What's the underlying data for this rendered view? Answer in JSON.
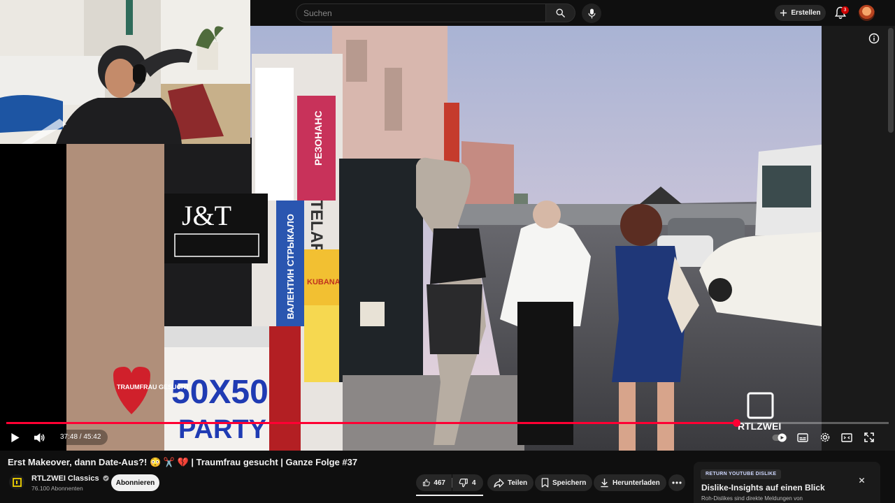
{
  "search": {
    "placeholder": "Suchen"
  },
  "header": {
    "create_label": "Erstellen",
    "notification_count": "3"
  },
  "player": {
    "current_time": "37:48",
    "duration": "45:42",
    "time_separator": " / ",
    "progress_fraction": 0.827,
    "overlay_show_logo": "TRAUMFRAU GESUCHT",
    "overlay_channel_logo": "RTLZWEI",
    "accent_color": "#ff0033"
  },
  "sign_texts": {
    "jt": "J&T",
    "party": "50X50",
    "party2": "PARTY",
    "stelar": "PAROV STELAR",
    "valentin": "ВАЛЕНТИН СТРЫКАЛО",
    "kubana": "KUBANA",
    "rezonans": "РЕЗОНАНС"
  },
  "video": {
    "title": "Erst Makeover, dann Date-Aus?! 😳 ✂️ 💔 | Traumfrau gesucht | Ganze Folge #37",
    "channel_name": "RTLZWEI Classics",
    "subscribers": "76.100 Abonnenten",
    "subscribe_label": "Abonnieren",
    "likes": "467",
    "dislikes": "4",
    "share_label": "Teilen",
    "save_label": "Speichern",
    "download_label": "Herunterladen"
  },
  "rd_panel": {
    "badge": "RETURN YOUTUBE DISLIKE",
    "title": "Dislike-Insights auf einen Blick",
    "subtitle": "Roh-Dislikes sind direkte Meldungen von"
  }
}
